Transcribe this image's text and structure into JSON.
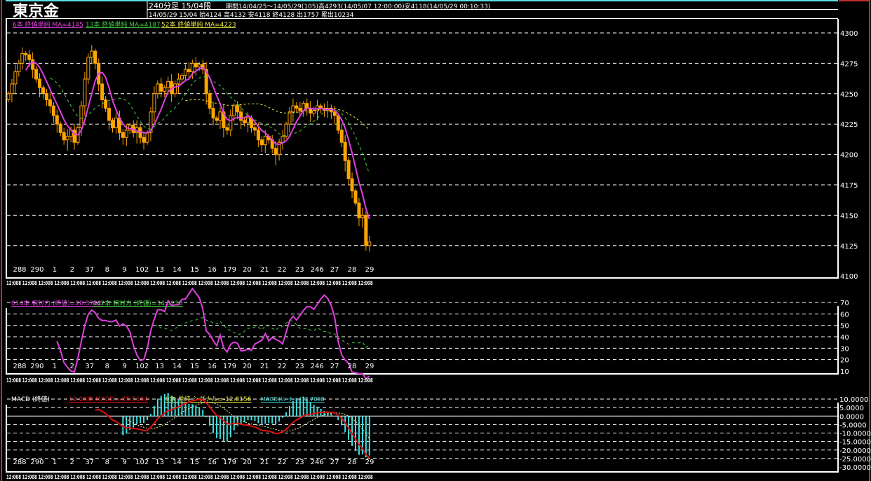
{
  "header": {
    "symbol": "東京金",
    "timeframe": "240分足 15/04限",
    "period_info": "期間14/04/25～14/05/29(105)高4293(14/05/07 12:00:00)安4118(14/05/29 00:10:33)",
    "last_bar": "14/05/29 15/04 始4124 高4132 安4118 終4128 出1757 累出10234"
  },
  "legends": {
    "ma6": "6本 終値単純 MA=4145",
    "ma13": "13本 終値単純 MA=4187",
    "ma52": "52本 終値単純 MA=4223",
    "rsi14": "014本 相対力 (終値)=20.3702",
    "rsi42": "042本 相対力 (終値)=34.8215",
    "macd_title": "MACD (終値)",
    "macd": "12-26本 MACD=-25.5164",
    "signal": "9本 単純 シグナル=-12.8156",
    "osc": "MACDｵｼﾚｰﾀｰ=-12.7008"
  },
  "colors": {
    "candle": "#ffa500",
    "ma6": "#e040e0",
    "ma13": "#40d040",
    "ma52": "#e8e840",
    "macd": "#e01010",
    "signal": "#f0f0a0",
    "osc": "#40e0e0",
    "frame": "#ffffff",
    "outer": "#c03030"
  },
  "chart_data": [
    {
      "type": "candlestick",
      "title": "東京金 240分足",
      "y_ticks": [
        4300,
        4275,
        4250,
        4225,
        4200,
        4175,
        4150,
        4125,
        4100
      ],
      "ylim": [
        4100,
        4300
      ],
      "day_labels": [
        "288",
        "290",
        "1",
        "2",
        "37",
        "8",
        "9",
        "102",
        "13",
        "14",
        "15",
        "16",
        "179",
        "20",
        "21",
        "22",
        "23",
        "246",
        "27",
        "28",
        "29"
      ],
      "time_label": "12:008",
      "time_label_count": 23,
      "close": [
        4250,
        4258,
        4268,
        4275,
        4283,
        4282,
        4278,
        4270,
        4262,
        4255,
        4250,
        4245,
        4240,
        4232,
        4225,
        4218,
        4212,
        4215,
        4220,
        4210,
        4222,
        4240,
        4262,
        4280,
        4285,
        4275,
        4258,
        4245,
        4238,
        4228,
        4222,
        4230,
        4218,
        4214,
        4220,
        4224,
        4218,
        4222,
        4214,
        4210,
        4218,
        4235,
        4250,
        4258,
        4252,
        4255,
        4260,
        4250,
        4258,
        4262,
        4265,
        4270,
        4268,
        4275,
        4272,
        4274,
        4270,
        4250,
        4238,
        4230,
        4228,
        4235,
        4222,
        4220,
        4232,
        4240,
        4235,
        4228,
        4226,
        4230,
        4222,
        4220,
        4212,
        4208,
        4215,
        4212,
        4205,
        4200,
        4210,
        4215,
        4225,
        4235,
        4240,
        4238,
        4236,
        4242,
        4238,
        4234,
        4236,
        4240,
        4238,
        4236,
        4238,
        4235,
        4232,
        4220,
        4210,
        4195,
        4180,
        4170,
        4160,
        4148,
        4150,
        4125,
        4128
      ],
      "ma_periods": [
        6,
        13,
        52
      ]
    },
    {
      "type": "line",
      "title": "RSI",
      "series": [
        "RSI 14",
        "RSI 42"
      ],
      "y_ticks": [
        70,
        60,
        50,
        40,
        30,
        20,
        10
      ],
      "ylim": [
        10,
        70
      ]
    },
    {
      "type": "bar+line",
      "title": "MACD",
      "series": [
        "MACD 12-26",
        "Signal 9",
        "Oscillator"
      ],
      "y_ticks": [
        "10.0000",
        "5.0000",
        "0.0000",
        "-5.0000",
        "-10.0000",
        "-15.0000",
        "-20.0000",
        "-25.0000",
        "-30.0000"
      ],
      "ylim": [
        -30,
        10
      ]
    }
  ]
}
